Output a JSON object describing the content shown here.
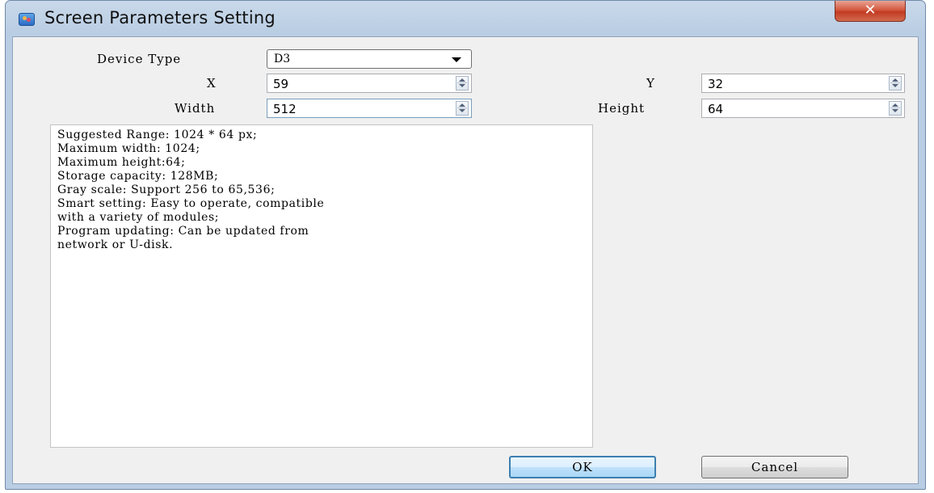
{
  "window": {
    "title": "Screen Parameters Setting",
    "close_glyph": "✕",
    "icon": "app-icon"
  },
  "form": {
    "device_type_label": "Device Type",
    "device_type_value": "D3",
    "x_label": "X",
    "x_value": "59",
    "y_label": "Y",
    "y_value": "32",
    "width_label": "Width",
    "width_value": "512",
    "height_label": "Height",
    "height_value": "64"
  },
  "description": "Suggested Range: 1024 * 64 px;\nMaximum width: 1024;\nMaximum height:64;\nStorage capacity: 128MB;\nGray scale: Support 256 to 65,536;\nSmart setting: Easy to operate, compatible\nwith a variety of modules;\nProgram updating: Can be updated from\nnetwork or U-disk.",
  "buttons": {
    "ok": "OK",
    "cancel": "Cancel"
  },
  "colors": {
    "titlebar": "#b9cde3",
    "close_button": "#c23a22",
    "ok_border": "#3c7fb1"
  }
}
